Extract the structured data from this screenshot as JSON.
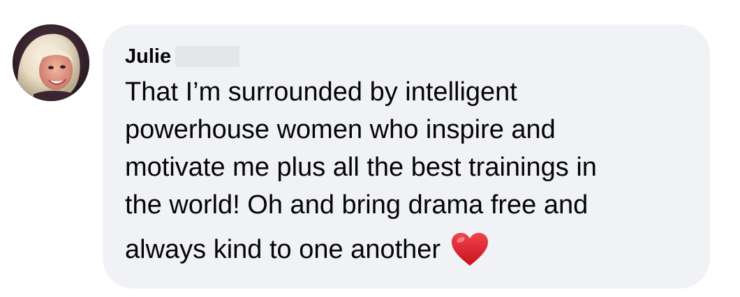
{
  "comment": {
    "author": "Julie",
    "lines": [
      "That I’m surrounded by intelligent",
      "powerhouse women who inspire and",
      "motivate me plus all the best trainings in",
      "the world! Oh and bring drama free and",
      "always kind to one another"
    ],
    "trailing_emoji": "red-heart-icon"
  },
  "colors": {
    "bubble_background": "#f0f2f5",
    "text": "#050505",
    "heart": "#e0202b",
    "redaction": "#e4e6e9"
  }
}
